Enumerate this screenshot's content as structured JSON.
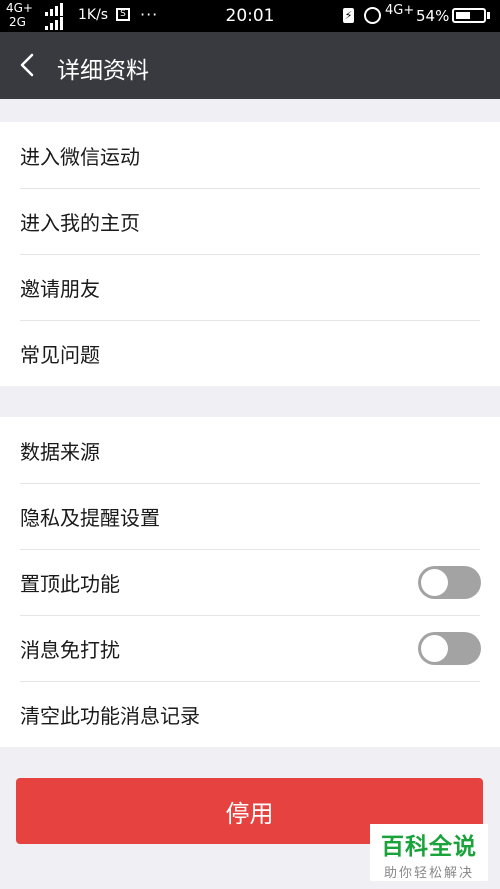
{
  "status_bar": {
    "net_top": "4G+",
    "net_bottom": "2G",
    "speed": "1K/s",
    "box_glyph": "S",
    "dots": "···",
    "time": "20:01",
    "net_right": "4G+",
    "battery_pct": "54%",
    "battery_level": 0.54,
    "icons": [
      "signal-icon",
      "notification-icon",
      "charging-icon",
      "alarm-icon",
      "battery-icon"
    ]
  },
  "header": {
    "title": "详细资料",
    "back_icon": "chevron-left-icon"
  },
  "group1": {
    "items": [
      {
        "label": "进入微信运动"
      },
      {
        "label": "进入我的主页"
      },
      {
        "label": "邀请朋友"
      },
      {
        "label": "常见问题"
      }
    ]
  },
  "group2": {
    "items": [
      {
        "label": "数据来源"
      },
      {
        "label": "隐私及提醒设置"
      },
      {
        "label": "置顶此功能",
        "toggle": false
      },
      {
        "label": "消息免打扰",
        "toggle": false
      },
      {
        "label": "清空此功能消息记录"
      }
    ]
  },
  "disable_button": {
    "label": "停用"
  },
  "colors": {
    "title_bar": "#393a3f",
    "disable_button": "#e64340",
    "toggle_off": "#a3a3a3",
    "background": "#efeff4",
    "watermark_green": "#1aa33a"
  },
  "watermark": {
    "title": "百科全说",
    "subtitle": "助你轻松解决"
  }
}
